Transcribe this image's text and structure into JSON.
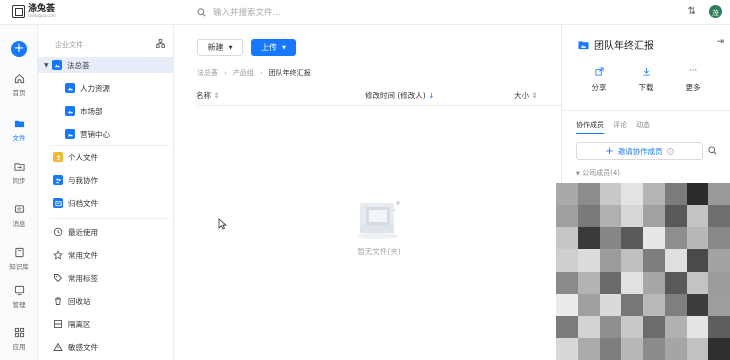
{
  "app": {
    "logo_name": "涤兔荟",
    "logo_sub": "tootoguo.com"
  },
  "search": {
    "placeholder": "输入并搜索文件..."
  },
  "user": {
    "avatar": "茂"
  },
  "rail": [
    {
      "label": "首页",
      "icon": "home-icon"
    },
    {
      "label": "文件",
      "icon": "folder-icon",
      "active": true
    },
    {
      "label": "同步",
      "icon": "sync-icon"
    },
    {
      "label": "消息",
      "icon": "message-icon"
    },
    {
      "label": "知识库",
      "icon": "book-icon"
    },
    {
      "label": "管理",
      "icon": "manage-icon"
    },
    {
      "label": "应用",
      "icon": "apps-icon"
    }
  ],
  "tree": {
    "header": "企业文件",
    "root": "法总荟",
    "children": [
      "人力资源",
      "市场部",
      "营销中心"
    ],
    "sections_a": [
      "个人文件",
      "与我协作",
      "归档文件"
    ],
    "sections_b": [
      "最近使用",
      "常用文件",
      "常用标签",
      "回收站",
      "隔离区",
      "敏感文件"
    ]
  },
  "toolbar": {
    "new_label": "新建",
    "upload_label": "上传"
  },
  "breadcrumb": [
    "法总荟",
    "产品组",
    "团队年终汇报"
  ],
  "columns": {
    "name": "名称",
    "modified": "修改时间 (修改人)",
    "size": "大小"
  },
  "empty": {
    "text": "暂无文件(夹)"
  },
  "panel": {
    "title": "团队年终汇报",
    "actions": [
      "分享",
      "下载",
      "更多"
    ],
    "tabs": [
      "协作成员",
      "评论",
      "动态"
    ],
    "invite_label": "邀请协作成员",
    "members_label": "公司成员(4)"
  },
  "mosaic": [
    "#a9a9a9",
    "#8c8c8c",
    "#c9c9c9",
    "#e3e3e3",
    "#b5b5b5",
    "#7c7c7c",
    "#2b2b2b",
    "#9a9a9a",
    "#9f9f9f",
    "#7a7a7a",
    "#b0b0b0",
    "#d7d7d7",
    "#a1a1a1",
    "#595959",
    "#c4c4c4",
    "#6e6e6e",
    "#c6c6c6",
    "#3a3a3a",
    "#878787",
    "#5a5a5a",
    "#e7e7e7",
    "#8e8e8e",
    "#b8b8b8",
    "#888888",
    "#cfcfcf",
    "#dcdcdc",
    "#9b9b9b",
    "#c0c0c0",
    "#7e7e7e",
    "#e0e0e0",
    "#4a4a4a",
    "#a3a3a3",
    "#8a8a8a",
    "#b3b3b3",
    "#6b6b6b",
    "#e1e1e1",
    "#a7a7a7",
    "#595959",
    "#c3c3c3",
    "#9c9c9c",
    "#ebebeb",
    "#a0a0a0",
    "#dadada",
    "#777777",
    "#b9b9b9",
    "#7f7f7f",
    "#3d3d3d",
    "#9e9e9e",
    "#7b7b7b",
    "#d3d3d3",
    "#8f8f8f",
    "#c8c8c8",
    "#6c6c6c",
    "#b1b1b1",
    "#e4e4e4",
    "#5e5e5e",
    "#d8d8d8",
    "#ababab",
    "#7d7d7d",
    "#b7b7b7",
    "#8b8b8b",
    "#a5a5a5",
    "#c2c2c2",
    "#2f2f2f"
  ]
}
